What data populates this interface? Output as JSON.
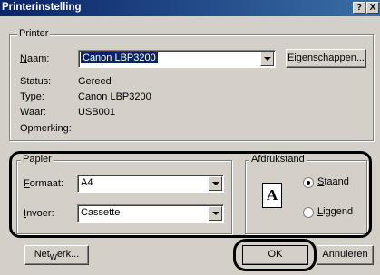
{
  "window": {
    "title": "Printerinstelling",
    "help_glyph": "?",
    "close_glyph": "X"
  },
  "printer": {
    "group_label": "Printer",
    "name_label": "Naam:",
    "name_value": "Canon LBP3200",
    "properties_button": "Eigenschappen...",
    "status_label": "Status:",
    "status_value": "Gereed",
    "type_label": "Type:",
    "type_value": "Canon LBP3200",
    "where_label": "Waar:",
    "where_value": "USB001",
    "comment_label": "Opmerking:"
  },
  "paper": {
    "group_label": "Papier",
    "format_label": "Formaat:",
    "format_value": "A4",
    "source_label": "Invoer:",
    "source_value": "Cassette"
  },
  "orientation": {
    "group_label": "Afdrukstand",
    "icon_letter": "A",
    "portrait_label": "Staand",
    "landscape_label": "Liggend",
    "selected": "Staand"
  },
  "buttons": {
    "network": "Netwerk...",
    "ok": "OK",
    "cancel": "Annuleren"
  }
}
